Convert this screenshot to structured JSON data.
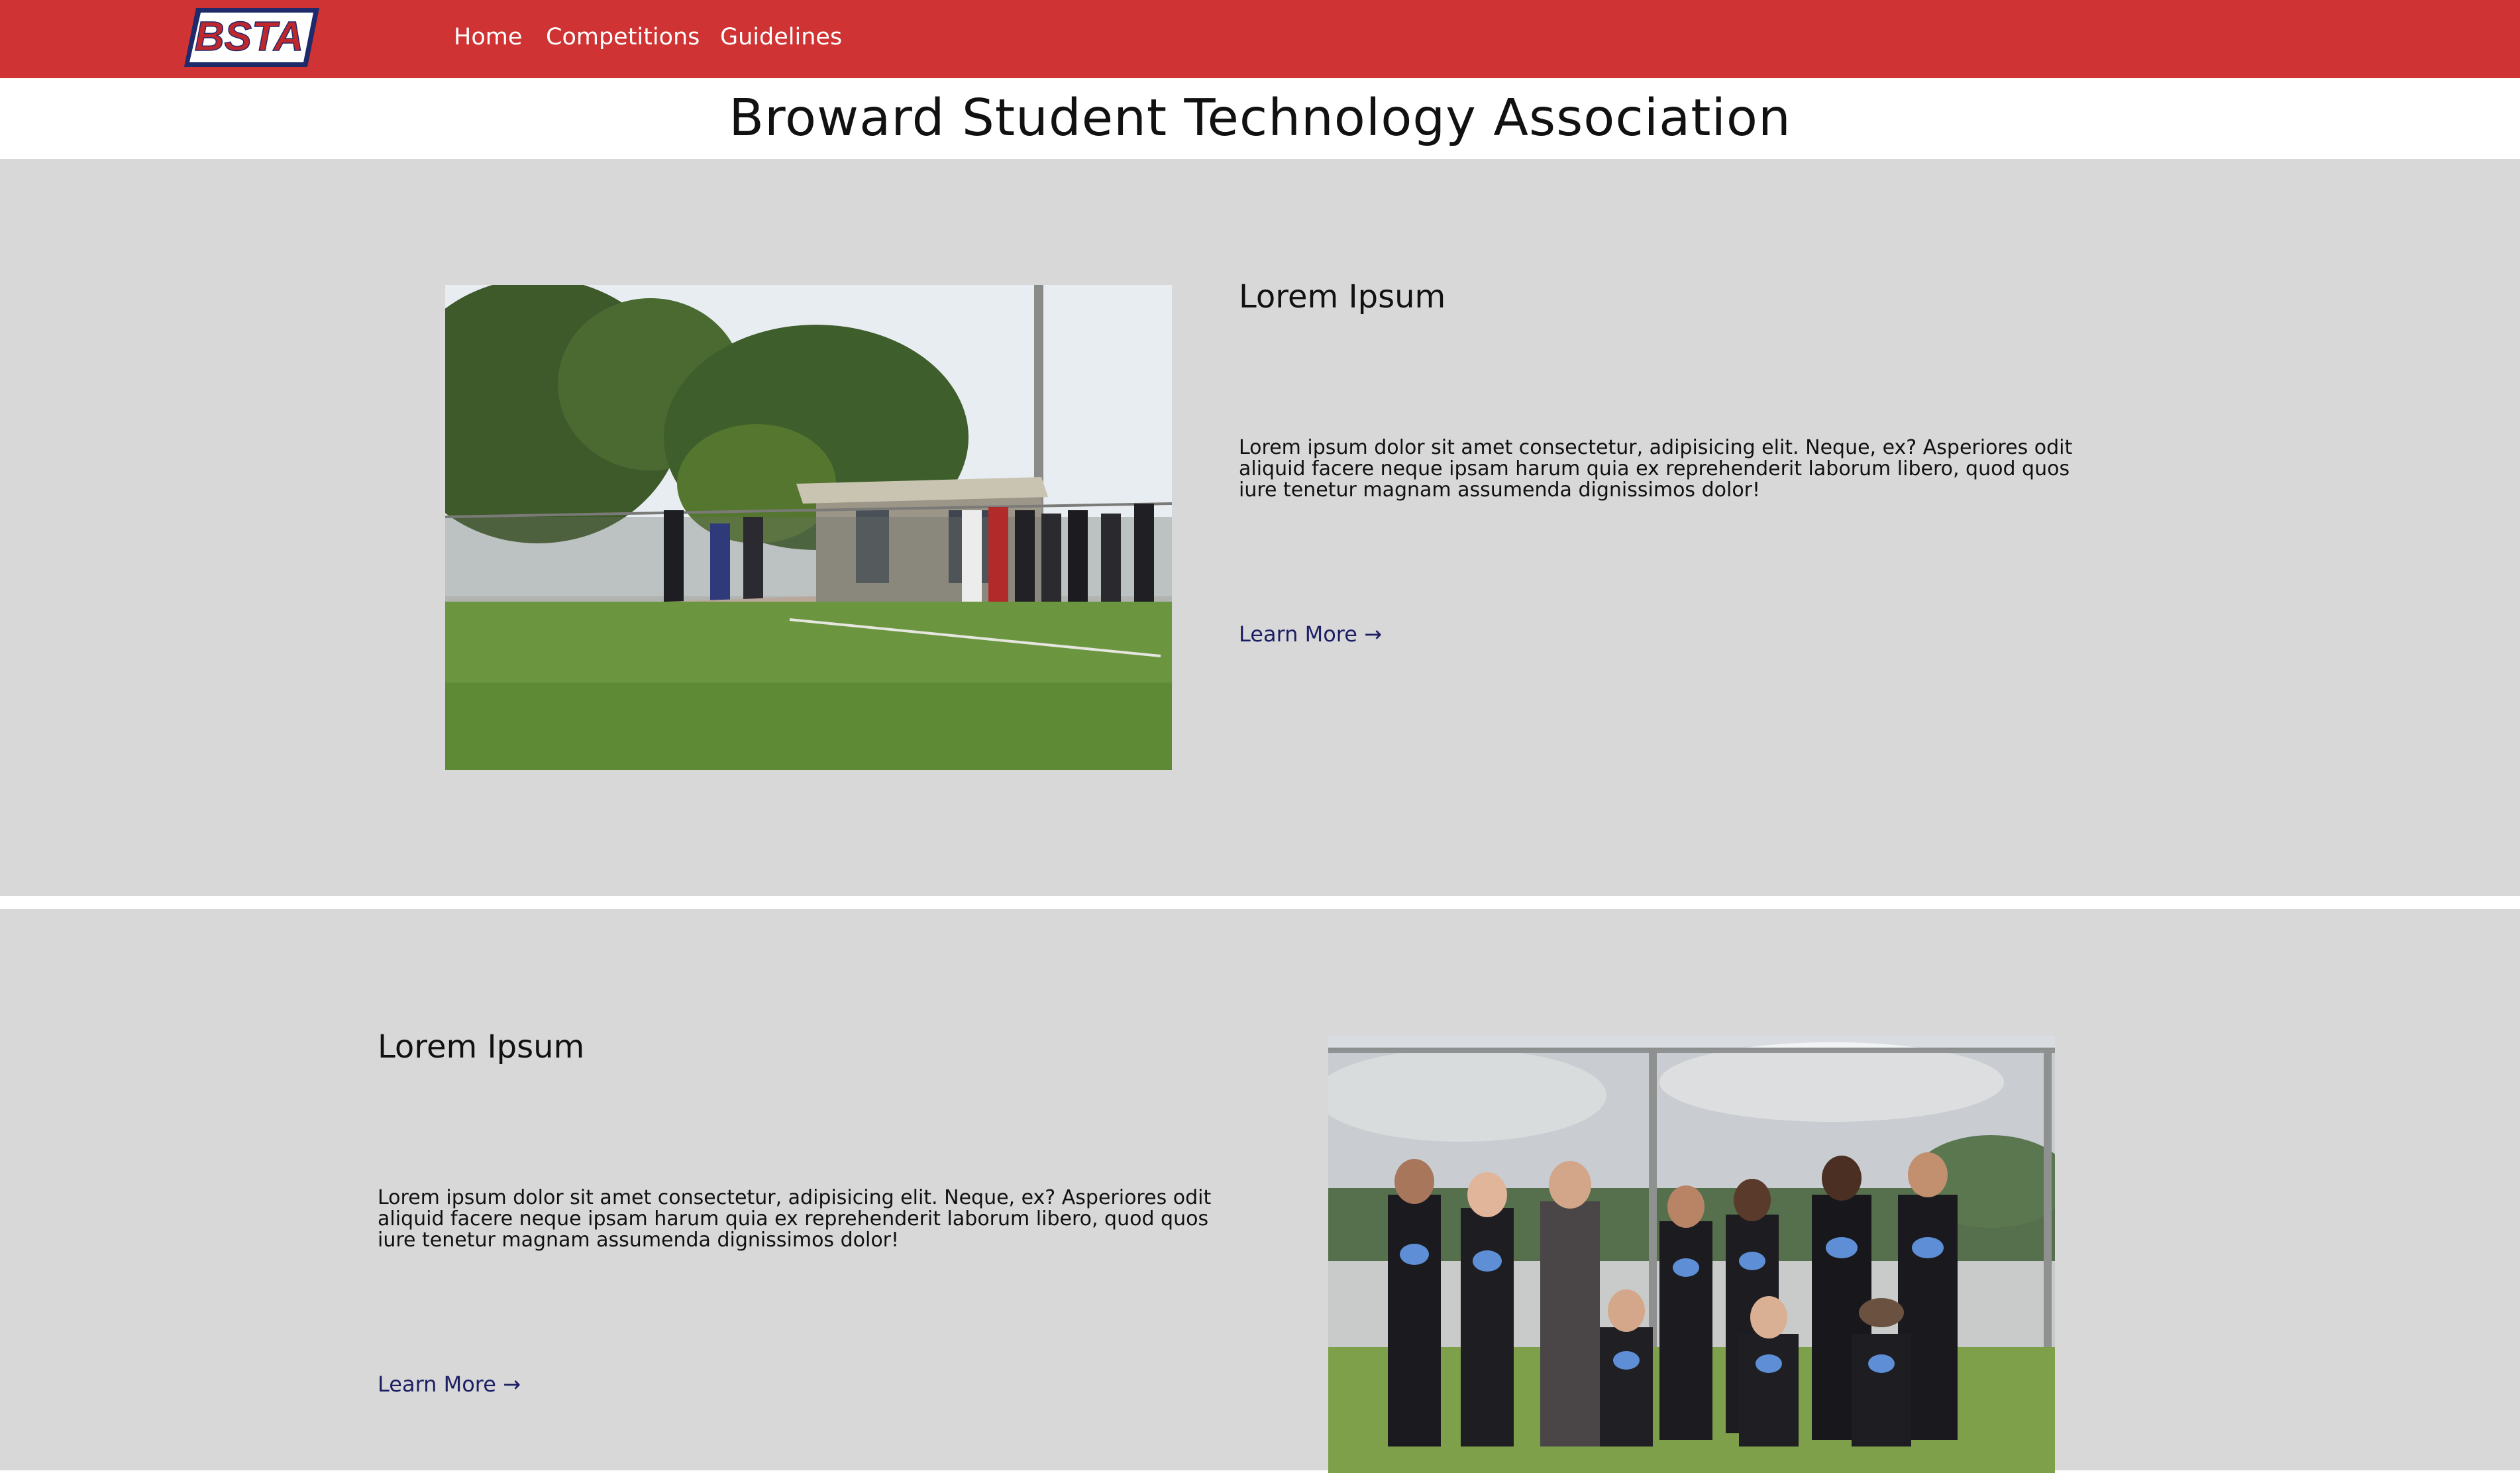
{
  "nav": {
    "logo_text": "BSTA",
    "items": [
      {
        "label": "Home"
      },
      {
        "label": "Competitions"
      },
      {
        "label": "Guidelines"
      }
    ]
  },
  "header": {
    "title": "Broward Student Technology Association"
  },
  "sections": [
    {
      "heading": "Lorem Ipsum",
      "body": "Lorem ipsum dolor sit amet consectetur, adipisicing elit. Neque, ex? Asperiores odit aliquid facere neque ipsam harum quia ex reprehenderit laborum libero, quod quos iure tenetur magnam assumenda dignissimos dolor!",
      "link": "Learn More →",
      "image": "photo of students gathered on a grass field by a baseball dugout"
    },
    {
      "heading": "Lorem Ipsum",
      "body": "Lorem ipsum dolor sit amet consectetur, adipisicing elit. Neque, ex? Asperiores odit aliquid facere neque ipsam harum quia ex reprehenderit laborum libero, quod quos iure tenetur magnam assumenda dignissimos dolor!",
      "link": "Learn More →",
      "image": "group photo of students in black team shirts in front of a chain-link fence"
    }
  ],
  "colors": {
    "nav_bg": "#cf3333",
    "section_bg": "#d8d8d8",
    "link": "#1b1e63",
    "logo_border": "#1f2a6b",
    "logo_text": "#c0272d"
  }
}
